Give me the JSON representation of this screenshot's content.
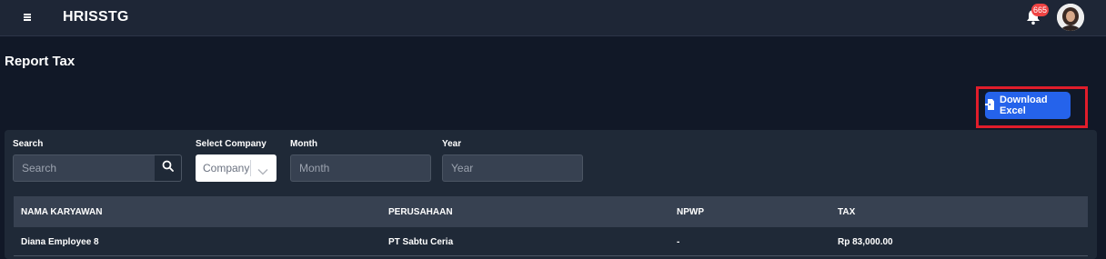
{
  "header": {
    "app_title": "HRISSTG",
    "notification_count": "665"
  },
  "page": {
    "title": "Report Tax",
    "download_label": "Download Excel"
  },
  "filters": {
    "search_label": "Search",
    "search_placeholder": "Search",
    "company_label": "Select Company",
    "company_value": "Company",
    "month_label": "Month",
    "month_placeholder": "Month",
    "year_label": "Year",
    "year_placeholder": "Year"
  },
  "table": {
    "columns": [
      "NAMA KARYAWAN",
      "PERUSAHAAN",
      "NPWP",
      "TAX"
    ],
    "rows": [
      [
        "Diana Employee 8",
        "PT Sabtu Ceria",
        "-",
        "Rp 83,000.00"
      ]
    ]
  },
  "colors": {
    "topbar": "#1e2636",
    "background": "#111827",
    "card": "#1f2937",
    "primary": "#2563eb",
    "highlight": "#e11d2b",
    "badge": "#ef4444"
  }
}
